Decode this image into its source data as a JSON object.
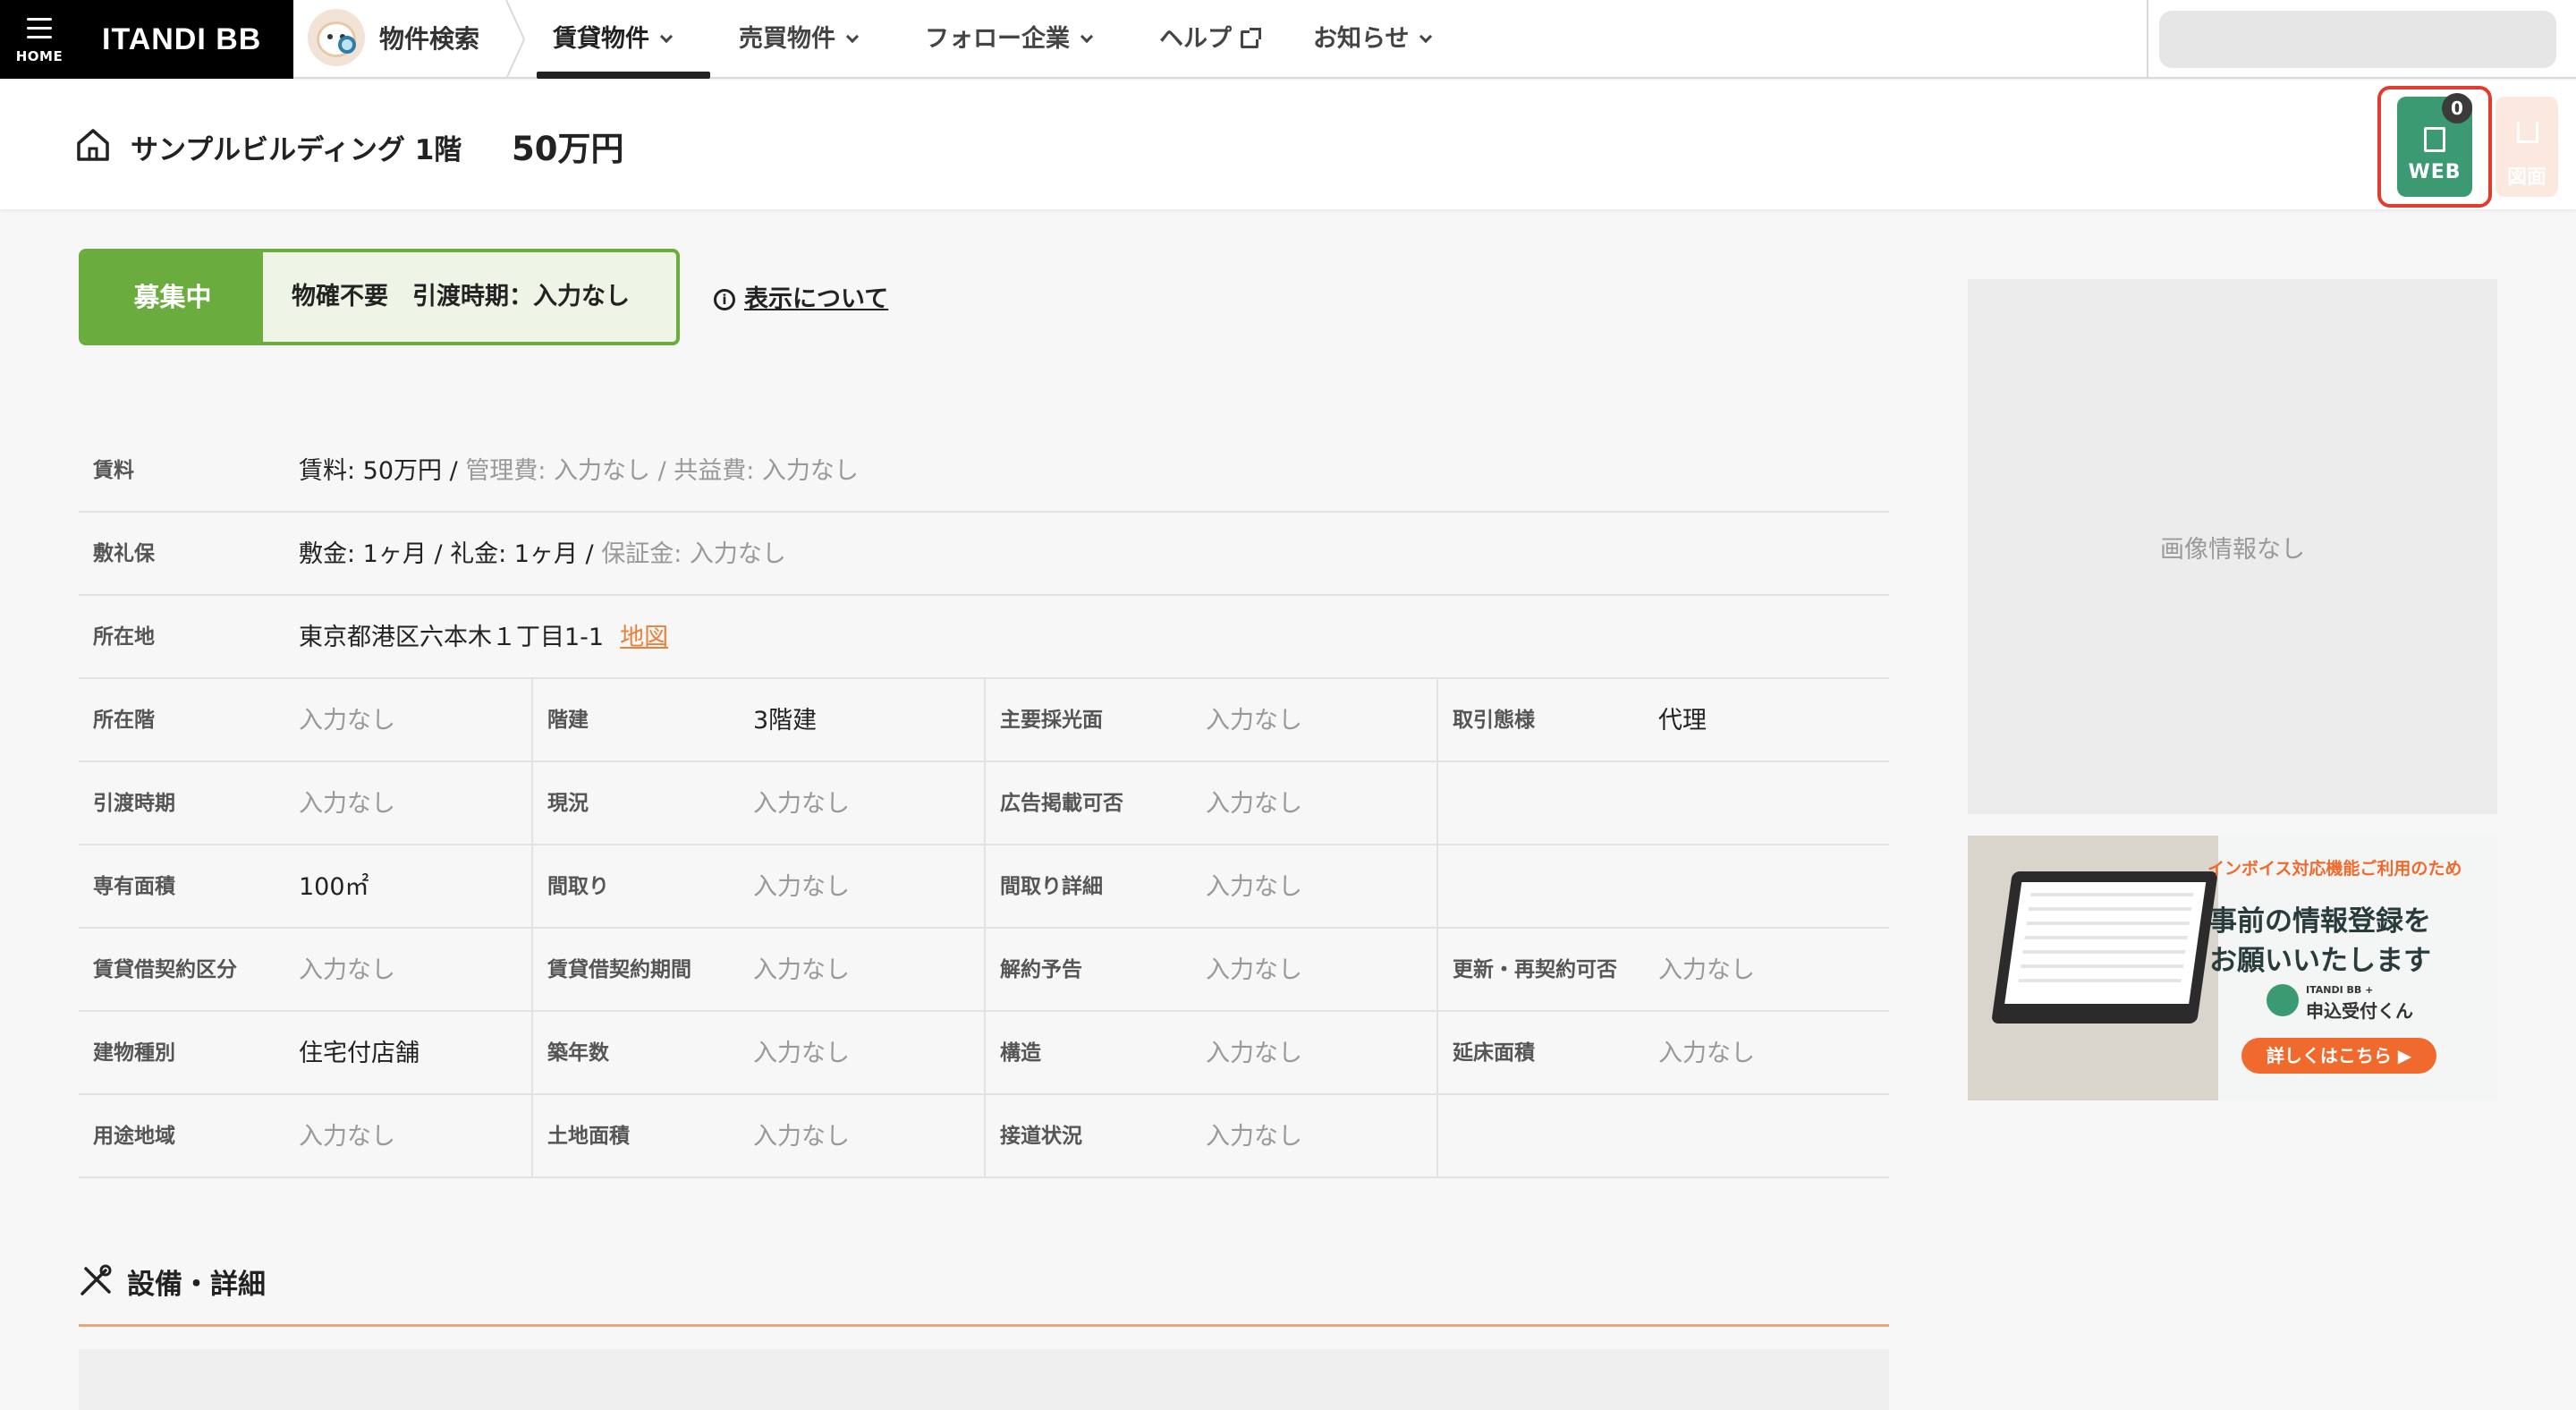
{
  "nav": {
    "home_label": "HOME",
    "brand": "ITANDI BB",
    "search_label": "物件検索",
    "items": [
      {
        "label": "賃貸物件",
        "active": true
      },
      {
        "label": "売買物件"
      },
      {
        "label": "フォロー企業"
      },
      {
        "label": "ヘルプ"
      },
      {
        "label": "お知らせ"
      }
    ]
  },
  "header": {
    "building": "サンプルビルディング 1階",
    "price": "50万円",
    "web_label": "WEB",
    "web_count": "0",
    "zumen_label": "図面"
  },
  "status": {
    "tag": "募集中",
    "text": "物確不要　引渡時期：入力なし",
    "info_link": "表示について"
  },
  "details": {
    "rent": {
      "label": "賃料",
      "value": "賃料: 50万円 / ",
      "muted": "管理費: 入力なし / 共益費: 入力なし"
    },
    "deposit": {
      "label": "敷礼保",
      "value": "敷金: 1ヶ月 / 礼金: 1ヶ月 / ",
      "muted": "保証金: 入力なし"
    },
    "address": {
      "label": "所在地",
      "value": "東京都港区六本木１丁目1-1",
      "map": "地図"
    },
    "grid": [
      [
        {
          "label": "所在階",
          "value": "入力なし",
          "muted": true
        },
        {
          "label": "階建",
          "value": "3階建",
          "muted": false
        },
        {
          "label": "主要採光面",
          "value": "入力なし",
          "muted": true
        },
        {
          "label": "取引態様",
          "value": "代理",
          "muted": false
        }
      ],
      [
        {
          "label": "引渡時期",
          "value": "入力なし",
          "muted": true
        },
        {
          "label": "現況",
          "value": "入力なし",
          "muted": true
        },
        {
          "label": "広告掲載可否",
          "value": "入力なし",
          "muted": true
        },
        {
          "label": "",
          "value": "",
          "muted": true
        }
      ],
      [
        {
          "label": "専有面積",
          "value": "100㎡",
          "muted": false
        },
        {
          "label": "間取り",
          "value": "入力なし",
          "muted": true
        },
        {
          "label": "間取り詳細",
          "value": "入力なし",
          "muted": true
        },
        {
          "label": "",
          "value": "",
          "muted": true
        }
      ],
      [
        {
          "label": "賃貸借契約区分",
          "value": "入力なし",
          "muted": true
        },
        {
          "label": "賃貸借契約期間",
          "value": "入力なし",
          "muted": true
        },
        {
          "label": "解約予告",
          "value": "入力なし",
          "muted": true
        },
        {
          "label": "更新・再契約可否",
          "value": "入力なし",
          "muted": true
        }
      ],
      [
        {
          "label": "建物種別",
          "value": "住宅付店舗",
          "muted": false
        },
        {
          "label": "築年数",
          "value": "入力なし",
          "muted": true
        },
        {
          "label": "構造",
          "value": "入力なし",
          "muted": true
        },
        {
          "label": "延床面積",
          "value": "入力なし",
          "muted": true
        }
      ],
      [
        {
          "label": "用途地域",
          "value": "入力なし",
          "muted": true
        },
        {
          "label": "土地面積",
          "value": "入力なし",
          "muted": true
        },
        {
          "label": "接道状況",
          "value": "入力なし",
          "muted": true
        },
        {
          "label": "",
          "value": "",
          "muted": true
        }
      ]
    ]
  },
  "section": {
    "title": "設備・詳細"
  },
  "side": {
    "no_image": "画像情報なし",
    "ad": {
      "sub": "インボイス対応機能ご利用のため",
      "line1": "事前の情報登録を",
      "line2": "お願いいたします",
      "product_small": "ITANDI BB +",
      "product": "申込受付くん",
      "cta": "詳しくはこちら ▶"
    }
  },
  "colors": {
    "accent_green": "#6aac3e",
    "web_green": "#3c9a73",
    "highlight_red": "#e33b2e",
    "link_orange": "#e8823a"
  }
}
